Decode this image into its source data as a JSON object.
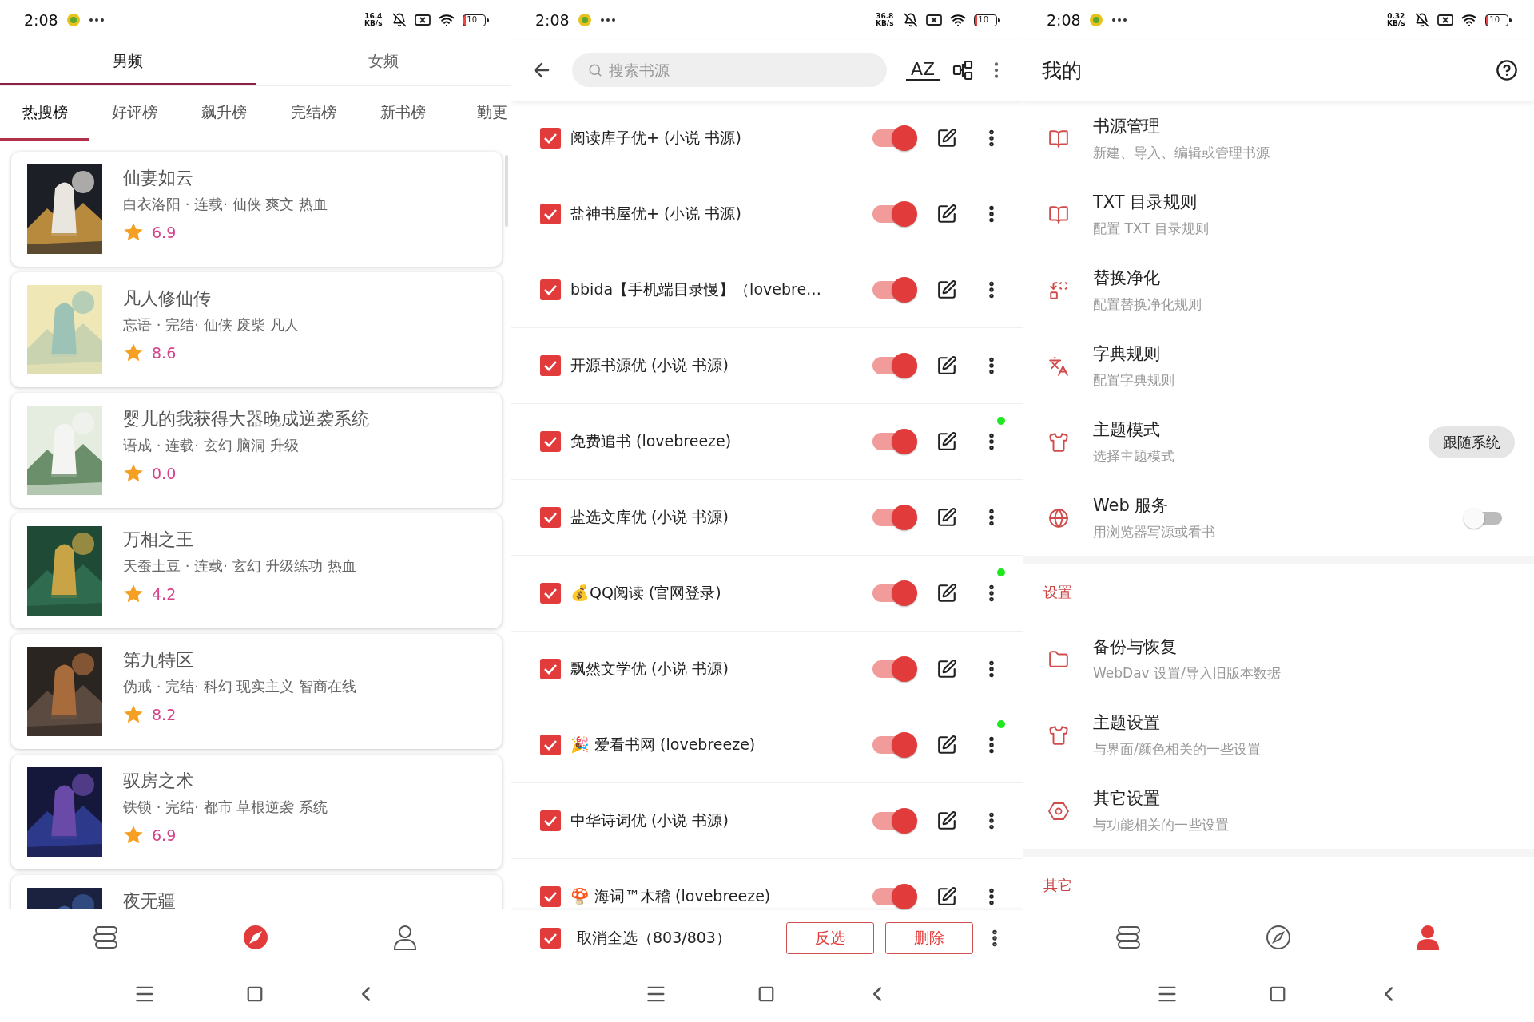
{
  "discover": {
    "status_bar": {
      "time": "2:08",
      "speed": "16.4 KB/s",
      "battery": "10"
    },
    "gender_tabs": [
      {
        "label": "男频",
        "selected": true
      },
      {
        "label": "女频",
        "selected": false
      }
    ],
    "rank_tabs": [
      {
        "label": "热搜榜",
        "selected": true
      },
      {
        "label": "好评榜",
        "selected": false
      },
      {
        "label": "飙升榜",
        "selected": false
      },
      {
        "label": "完结榜",
        "selected": false
      },
      {
        "label": "新书榜",
        "selected": false
      },
      {
        "label": "勤更",
        "selected": false
      }
    ],
    "books": [
      {
        "title": "仙妻如云",
        "meta": "白衣洛阳 · 连载· 仙侠 爽文 热血",
        "score": "6.9"
      },
      {
        "title": "凡人修仙传",
        "meta": "忘语 · 完结· 仙侠 废柴 凡人",
        "score": "8.6"
      },
      {
        "title": "婴儿的我获得大器晚成逆袭系统",
        "meta": "语成 · 连载· 玄幻 脑洞 升级",
        "score": "0.0"
      },
      {
        "title": "万相之王",
        "meta": "天蚕土豆 · 连载· 玄幻 升级练功 热血",
        "score": "4.2"
      },
      {
        "title": "第九特区",
        "meta": "伪戒 · 完结· 科幻 现实主义 智商在线",
        "score": "8.2"
      },
      {
        "title": "驭房之术",
        "meta": "铁锁 · 完结· 都市 草根逆袭 系统",
        "score": "6.9"
      },
      {
        "title": "夜无疆"
      }
    ],
    "nav": [
      {
        "kind": "bookshelf",
        "selected": false
      },
      {
        "kind": "compass",
        "selected": true
      },
      {
        "kind": "person",
        "selected": false
      }
    ]
  },
  "sources": {
    "status_bar": {
      "time": "2:08",
      "speed": "36.8 KB/s",
      "battery": "10"
    },
    "search": {
      "placeholder": "搜索书源"
    },
    "sort_label": "AZ",
    "rows": [
      {
        "name": "阅读库子优+ (小说 书源)",
        "checked": true,
        "enabled": true,
        "dot": false
      },
      {
        "name": "盐神书屋优+ (小说 书源)",
        "checked": true,
        "enabled": true,
        "dot": false
      },
      {
        "name": "bbida【手机端目录慢】（lovebre…",
        "checked": true,
        "enabled": true,
        "dot": false
      },
      {
        "name": "开源书源优 (小说 书源)",
        "checked": true,
        "enabled": true,
        "dot": false
      },
      {
        "name": "免费追书 (lovebreeze)",
        "checked": true,
        "enabled": true,
        "dot": true
      },
      {
        "name": "盐选文库优 (小说 书源)",
        "checked": true,
        "enabled": true,
        "dot": false
      },
      {
        "name": "💰QQ阅读 (官网登录)",
        "checked": true,
        "enabled": true,
        "dot": true
      },
      {
        "name": "飘然文学优 (小说 书源)",
        "checked": true,
        "enabled": true,
        "dot": false
      },
      {
        "name": "🎉 爱看书网 (lovebreeze)",
        "checked": true,
        "enabled": true,
        "dot": true
      },
      {
        "name": "中华诗词优 (小说 书源)",
        "checked": true,
        "enabled": true,
        "dot": false
      },
      {
        "name": "🍄 海词™木稽 (lovebreeze)",
        "checked": true,
        "enabled": true,
        "dot": false
      }
    ],
    "footer": {
      "checked": true,
      "label": "取消全选（803/803）",
      "buttons": [
        "反选",
        "删除"
      ]
    }
  },
  "mine": {
    "status_bar": {
      "time": "2:08",
      "speed": "0.32 KB/s",
      "battery": "10"
    },
    "title": "我的",
    "sections": [
      {
        "items": [
          {
            "kind": "book",
            "title": "书源管理",
            "subtitle": "新建、导入、编辑或管理书源"
          },
          {
            "kind": "book",
            "title": "TXT 目录规则",
            "subtitle": "配置 TXT 目录规则"
          },
          {
            "kind": "replace",
            "title": "替换净化",
            "subtitle": "配置替换净化规则"
          },
          {
            "kind": "translate",
            "title": "字典规则",
            "subtitle": "配置字典规则"
          },
          {
            "kind": "shirt",
            "title": "主题模式",
            "subtitle": "选择主题模式",
            "chip": "跟随系统"
          },
          {
            "kind": "globe",
            "title": "Web 服务",
            "subtitle": "用浏览器写源或看书",
            "on": false
          }
        ]
      },
      {
        "header": "设置",
        "items": [
          {
            "kind": "folder",
            "title": "备份与恢复",
            "subtitle": "WebDav 设置/导入旧版本数据"
          },
          {
            "kind": "shirt",
            "title": "主题设置",
            "subtitle": "与界面/颜色相关的一些设置"
          },
          {
            "kind": "hex",
            "title": "其它设置",
            "subtitle": "与功能相关的一些设置"
          }
        ]
      },
      {
        "header": "其它"
      }
    ],
    "nav": [
      {
        "kind": "bookshelf",
        "selected": false
      },
      {
        "kind": "compass",
        "selected": false
      },
      {
        "kind": "person",
        "selected": true
      }
    ]
  }
}
